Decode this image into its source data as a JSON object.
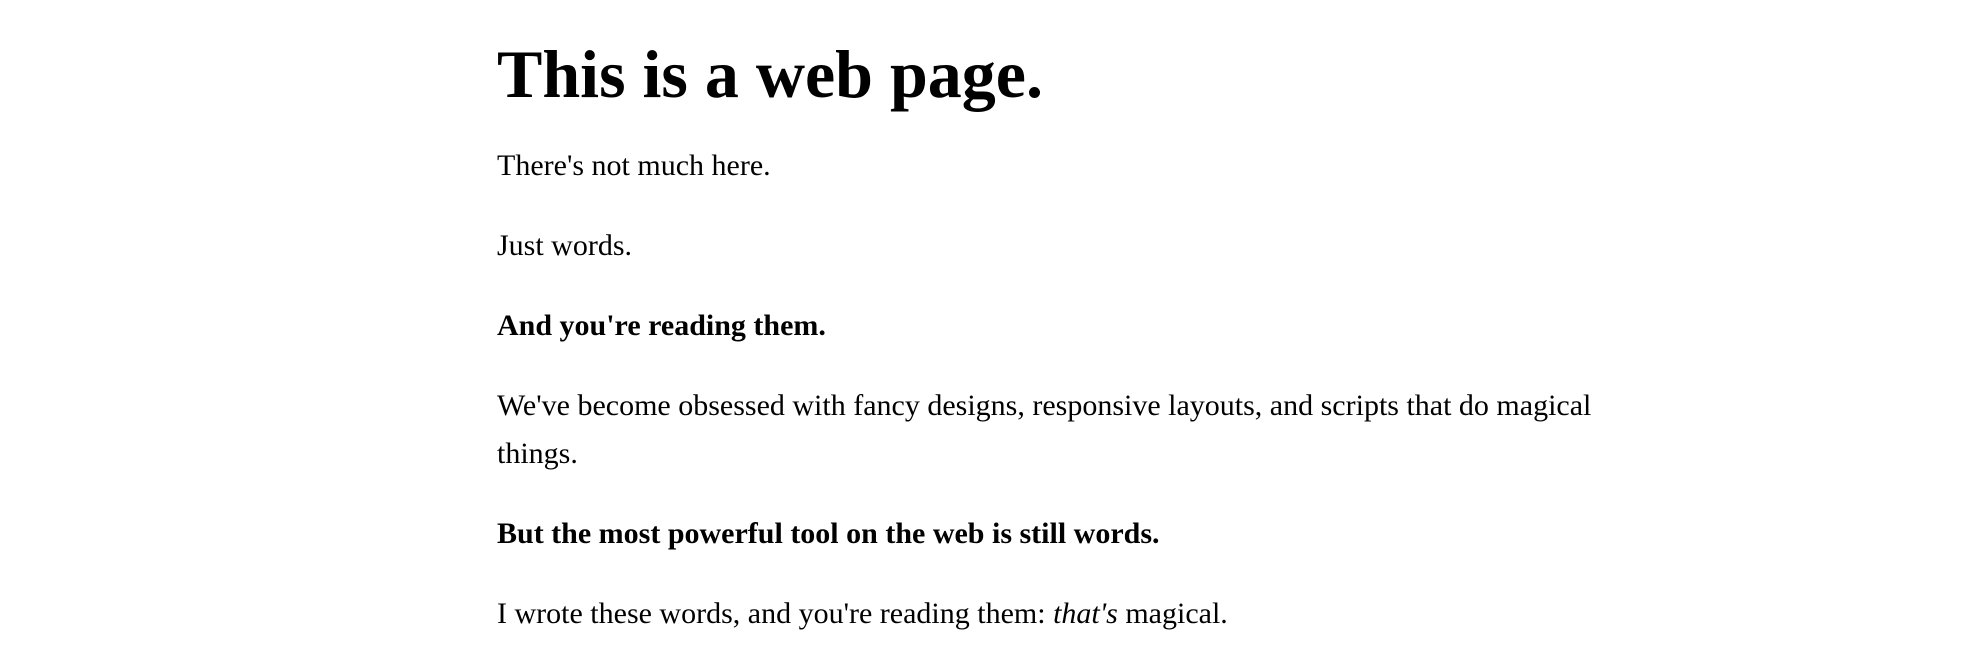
{
  "page": {
    "heading": "This is a web page.",
    "p1": "There's not much here.",
    "p2": "Just words.",
    "p3": "And you're reading them.",
    "p4": "We've become obsessed with fancy designs, responsive layouts, and scripts that do magical things.",
    "p5": "But the most powerful tool on the web is still words.",
    "p6": {
      "before": "I wrote these words, and you're reading them: ",
      "emphasis": "that's",
      "after": " magical."
    }
  }
}
